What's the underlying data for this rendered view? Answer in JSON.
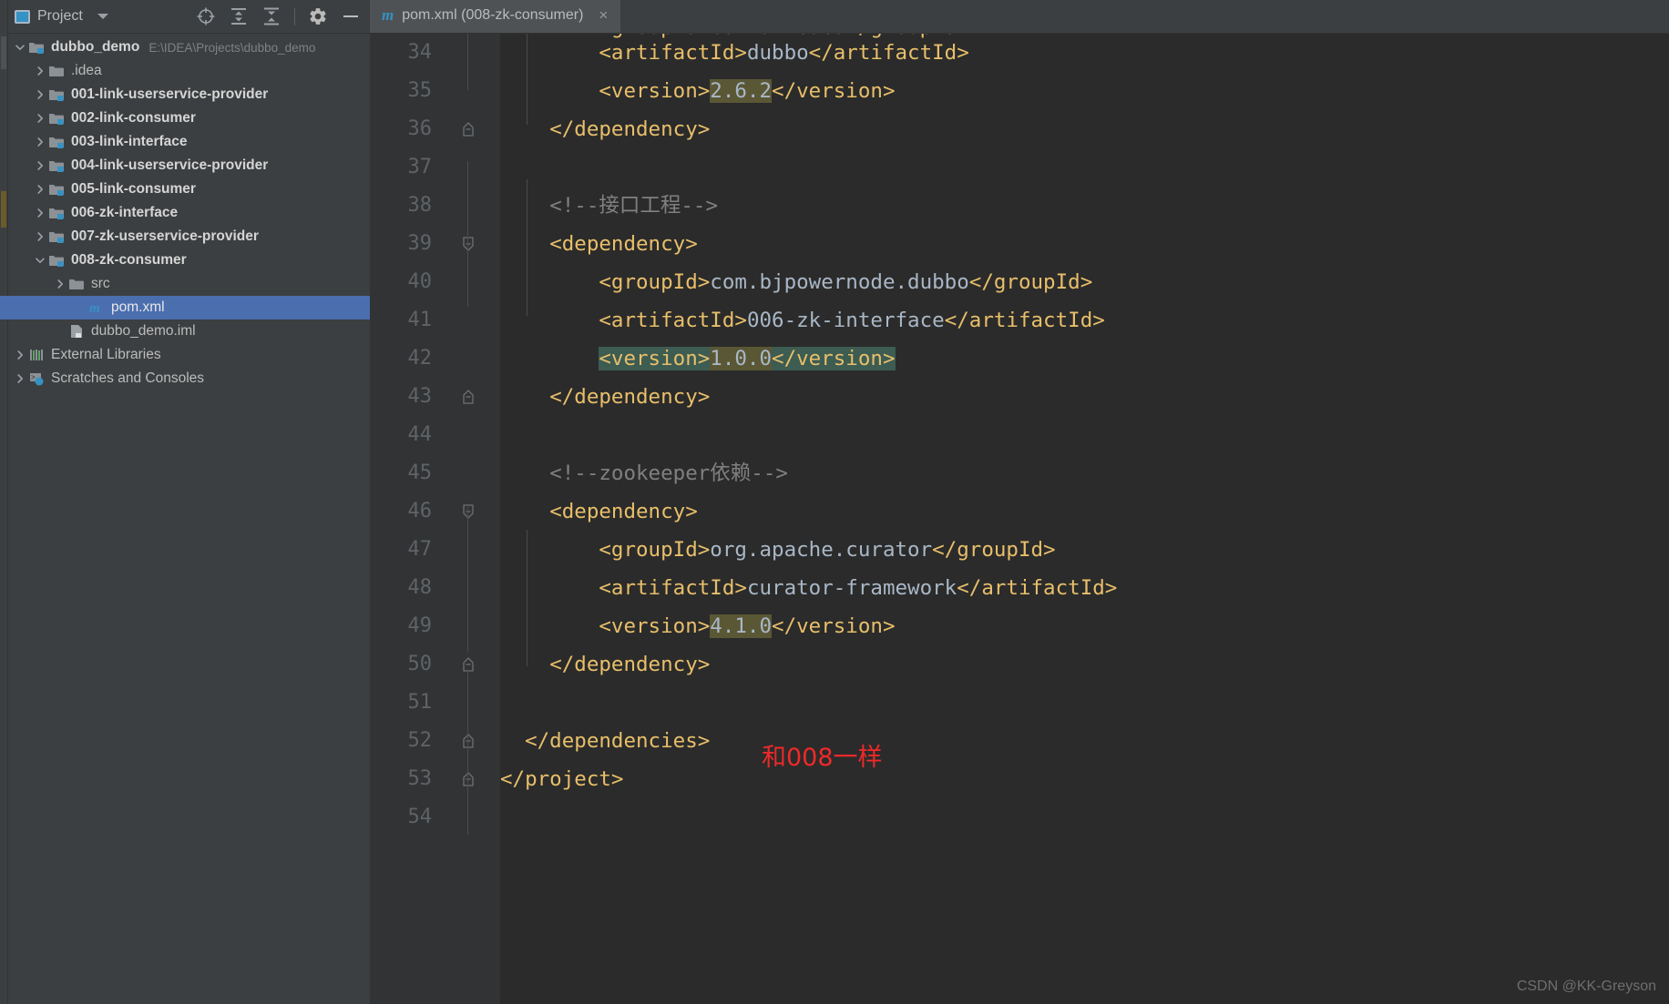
{
  "tool_window": {
    "title": "Project",
    "icons": [
      {
        "name": "locate-icon",
        "glyph": "target"
      },
      {
        "name": "expand-all-icon",
        "glyph": "expand"
      },
      {
        "name": "collapse-all-icon",
        "glyph": "collapse"
      },
      {
        "name": "gear-icon",
        "glyph": "gear"
      },
      {
        "name": "hide-icon",
        "glyph": "minus"
      }
    ]
  },
  "tree": {
    "items": [
      {
        "label": "dubbo_demo",
        "note": "E:\\IDEA\\Projects\\dubbo_demo",
        "indent": 0,
        "arrow": "down",
        "icon": "module-folder-icon",
        "bold": true,
        "selected": false
      },
      {
        "label": ".idea",
        "note": "",
        "indent": 1,
        "arrow": "right",
        "icon": "folder-icon",
        "bold": false,
        "selected": false
      },
      {
        "label": "001-link-userservice-provider",
        "note": "",
        "indent": 1,
        "arrow": "right",
        "icon": "module-folder-icon",
        "bold": true,
        "selected": false
      },
      {
        "label": "002-link-consumer",
        "note": "",
        "indent": 1,
        "arrow": "right",
        "icon": "module-folder-icon",
        "bold": true,
        "selected": false
      },
      {
        "label": "003-link-interface",
        "note": "",
        "indent": 1,
        "arrow": "right",
        "icon": "module-folder-icon",
        "bold": true,
        "selected": false
      },
      {
        "label": "004-link-userservice-provider",
        "note": "",
        "indent": 1,
        "arrow": "right",
        "icon": "module-folder-icon",
        "bold": true,
        "selected": false
      },
      {
        "label": "005-link-consumer",
        "note": "",
        "indent": 1,
        "arrow": "right",
        "icon": "module-folder-icon",
        "bold": true,
        "selected": false
      },
      {
        "label": "006-zk-interface",
        "note": "",
        "indent": 1,
        "arrow": "right",
        "icon": "module-folder-icon",
        "bold": true,
        "selected": false
      },
      {
        "label": "007-zk-userservice-provider",
        "note": "",
        "indent": 1,
        "arrow": "right",
        "icon": "module-folder-icon",
        "bold": true,
        "selected": false
      },
      {
        "label": "008-zk-consumer",
        "note": "",
        "indent": 1,
        "arrow": "down",
        "icon": "module-folder-icon",
        "bold": true,
        "selected": false
      },
      {
        "label": "src",
        "note": "",
        "indent": 2,
        "arrow": "right",
        "icon": "folder-icon",
        "bold": false,
        "selected": false
      },
      {
        "label": "pom.xml",
        "note": "",
        "indent": 3,
        "arrow": "none",
        "icon": "maven-icon",
        "bold": false,
        "selected": true
      },
      {
        "label": "dubbo_demo.iml",
        "note": "",
        "indent": 2,
        "arrow": "none",
        "icon": "iml-file-icon",
        "bold": false,
        "selected": false
      },
      {
        "label": "External Libraries",
        "note": "",
        "indent": 0,
        "arrow": "right",
        "icon": "libraries-icon",
        "bold": false,
        "selected": false
      },
      {
        "label": "Scratches and Consoles",
        "note": "",
        "indent": 0,
        "arrow": "right",
        "icon": "scratches-icon",
        "bold": false,
        "selected": false
      }
    ]
  },
  "editor": {
    "tab": {
      "icon": "maven-icon",
      "label": "pom.xml (008-zk-consumer)",
      "close": "×"
    },
    "clipped_top_line": "        <groupId>com.alibaba</groupId>",
    "annotation": "和008一样",
    "watermark": "CSDN @KK-Greyson",
    "first_line_number": 34,
    "lines": [
      {
        "n": 34,
        "fold": "none",
        "parts": [
          {
            "t": "        ",
            "c": "txt"
          },
          {
            "t": "<artifactId>",
            "c": "tag"
          },
          {
            "t": "dubbo",
            "c": "txt"
          },
          {
            "t": "</artifactId>",
            "c": "tag"
          }
        ]
      },
      {
        "n": 35,
        "fold": "none",
        "parts": [
          {
            "t": "        ",
            "c": "txt"
          },
          {
            "t": "<version>",
            "c": "tag"
          },
          {
            "t": "2.6.2",
            "c": "txt",
            "hl": "olive"
          },
          {
            "t": "</version>",
            "c": "tag"
          }
        ]
      },
      {
        "n": 36,
        "fold": "end",
        "parts": [
          {
            "t": "    ",
            "c": "txt"
          },
          {
            "t": "</dependency>",
            "c": "tag"
          }
        ]
      },
      {
        "n": 37,
        "fold": "none",
        "parts": []
      },
      {
        "n": 38,
        "fold": "none",
        "parts": [
          {
            "t": "    ",
            "c": "txt"
          },
          {
            "t": "<!--接口工程-->",
            "c": "cmt"
          }
        ]
      },
      {
        "n": 39,
        "fold": "start",
        "parts": [
          {
            "t": "    ",
            "c": "txt"
          },
          {
            "t": "<dependency>",
            "c": "tag"
          }
        ]
      },
      {
        "n": 40,
        "fold": "none",
        "parts": [
          {
            "t": "        ",
            "c": "txt"
          },
          {
            "t": "<groupId>",
            "c": "tag"
          },
          {
            "t": "com.bjpowernode.dubbo",
            "c": "txt"
          },
          {
            "t": "</groupId>",
            "c": "tag"
          }
        ]
      },
      {
        "n": 41,
        "fold": "none",
        "parts": [
          {
            "t": "        ",
            "c": "txt"
          },
          {
            "t": "<artifactId>",
            "c": "tag"
          },
          {
            "t": "006-zk-interface",
            "c": "txt"
          },
          {
            "t": "</artifactId>",
            "c": "tag"
          }
        ]
      },
      {
        "n": 42,
        "fold": "none",
        "current": true,
        "parts": [
          {
            "t": "        ",
            "c": "txt"
          },
          {
            "t": "<version>",
            "c": "tag",
            "hl": "teal"
          },
          {
            "t": "1.0.0",
            "c": "txt",
            "hl": "olive"
          },
          {
            "t": "</version>",
            "c": "tag",
            "hl": "teal"
          }
        ]
      },
      {
        "n": 43,
        "fold": "end",
        "parts": [
          {
            "t": "    ",
            "c": "txt"
          },
          {
            "t": "</dependency>",
            "c": "tag"
          }
        ]
      },
      {
        "n": 44,
        "fold": "none",
        "parts": []
      },
      {
        "n": 45,
        "fold": "none",
        "parts": [
          {
            "t": "    ",
            "c": "txt"
          },
          {
            "t": "<!--zookeeper依赖-->",
            "c": "cmt"
          }
        ]
      },
      {
        "n": 46,
        "fold": "start",
        "parts": [
          {
            "t": "    ",
            "c": "txt"
          },
          {
            "t": "<dependency>",
            "c": "tag"
          }
        ]
      },
      {
        "n": 47,
        "fold": "none",
        "parts": [
          {
            "t": "        ",
            "c": "txt"
          },
          {
            "t": "<groupId>",
            "c": "tag"
          },
          {
            "t": "org.apache.curator",
            "c": "txt"
          },
          {
            "t": "</groupId>",
            "c": "tag"
          }
        ]
      },
      {
        "n": 48,
        "fold": "none",
        "parts": [
          {
            "t": "        ",
            "c": "txt"
          },
          {
            "t": "<artifactId>",
            "c": "tag"
          },
          {
            "t": "curator-framework",
            "c": "txt"
          },
          {
            "t": "</artifactId>",
            "c": "tag"
          }
        ]
      },
      {
        "n": 49,
        "fold": "none",
        "parts": [
          {
            "t": "        ",
            "c": "txt"
          },
          {
            "t": "<version>",
            "c": "tag"
          },
          {
            "t": "4.1.0",
            "c": "txt",
            "hl": "olive"
          },
          {
            "t": "</version>",
            "c": "tag"
          }
        ]
      },
      {
        "n": 50,
        "fold": "end",
        "parts": [
          {
            "t": "    ",
            "c": "txt"
          },
          {
            "t": "</dependency>",
            "c": "tag"
          }
        ]
      },
      {
        "n": 51,
        "fold": "none",
        "parts": []
      },
      {
        "n": 52,
        "fold": "end",
        "parts": [
          {
            "t": "  ",
            "c": "txt"
          },
          {
            "t": "</dependencies>",
            "c": "tag"
          }
        ]
      },
      {
        "n": 53,
        "fold": "end",
        "parts": [
          {
            "t": "</project>",
            "c": "tag"
          }
        ]
      },
      {
        "n": 54,
        "fold": "none",
        "parts": []
      }
    ]
  },
  "colors": {
    "sidebar_bg": "#3c3f41",
    "editor_bg": "#2b2b2b",
    "gutter_bg": "#313335",
    "selection_blue": "#4b6eaf",
    "tag_yellow": "#e8bf6a",
    "value_blue_grey": "#a9b7c6",
    "comment_grey": "#808080",
    "highlight_olive": "#5a5735",
    "selection_teal": "#3d5c52",
    "annotation_red": "#ef2929",
    "accent_blue": "#3592c4"
  }
}
